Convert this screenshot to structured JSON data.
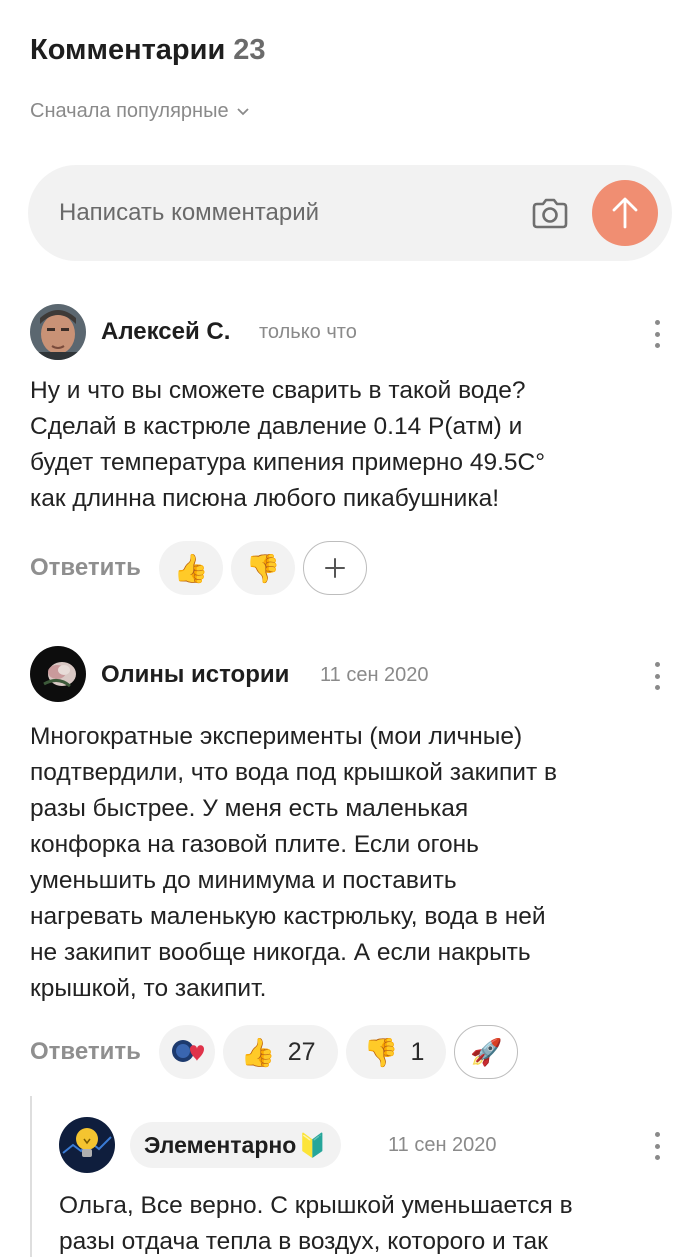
{
  "header": {
    "title": "Комментарии",
    "count": "23"
  },
  "sort": {
    "label": "Сначала популярные"
  },
  "composer": {
    "placeholder": "Написать комментарий"
  },
  "colors": {
    "accent": "#f08e72",
    "muted": "#8a8a8a",
    "chip_bg": "#f2f2f2"
  },
  "comments": [
    {
      "author": "Алексей С.",
      "time": "только что",
      "lines": [
        "Ну и что вы сможете сварить в такой воде?",
        "Сделай в кастрюле давление 0.14 Р(атм) и",
        "будет температура кипения примерно 49.5С°",
        "как длинна писюна любого пикабушника!"
      ],
      "reply_label": "Ответить"
    },
    {
      "author": "Олины истории",
      "time": "11 сен 2020",
      "lines": [
        "Многократные эксперименты (мои личные)",
        "подтвердили, что вода под крышкой закипит в",
        "разы быстрее. У меня есть маленькая",
        "конфорка на газовой плите. Если огонь",
        "уменьшить до минимума и поставить",
        "нагревать маленькую кастрюльку, вода в ней",
        "не закипит вообще никогда. А если накрыть",
        "крышкой, то закипит."
      ],
      "reply_label": "Ответить",
      "likes": "27",
      "dislikes": "1"
    },
    {
      "author": "Элементарно",
      "badge_icon": "🔰",
      "time": "11 сен 2020",
      "lines": [
        "Ольга, Все верно. С крышкой уменьшается в",
        "разы отдача тепла в воздух, которого и так"
      ]
    }
  ]
}
